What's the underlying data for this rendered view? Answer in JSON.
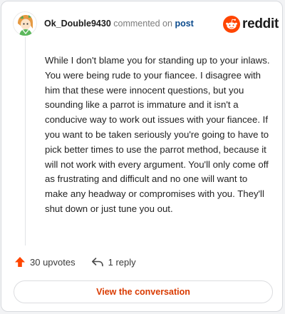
{
  "comment": {
    "username": "Ok_Double9430",
    "commented_on_text": "commented on",
    "post_link": "post",
    "body": "While I don't blame you for standing up to your inlaws. You were being rude to your fiancee. I disagree with him that these were innocent questions, but you sounding like a parrot is immature and it isn't a conducive way to work out issues with your fiancee. If you want to be taken seriously you're going to have to pick better times to use the parrot method, because it will not work with every argument. You'll only come off as frustrating and difficult and no one will want to make any headway or compromises with you. They'll shut down or just tune you out."
  },
  "brand": {
    "name": "reddit",
    "color": "#ff4500"
  },
  "actions": {
    "upvotes_label": "30 upvotes",
    "replies_label": "1 reply"
  },
  "cta": {
    "label": "View the conversation",
    "color": "#d93a00"
  },
  "icons": {
    "avatar": "avatar-icon",
    "logo": "reddit-logo-icon",
    "upvote": "upvote-arrow-icon",
    "reply": "reply-arrow-icon"
  }
}
